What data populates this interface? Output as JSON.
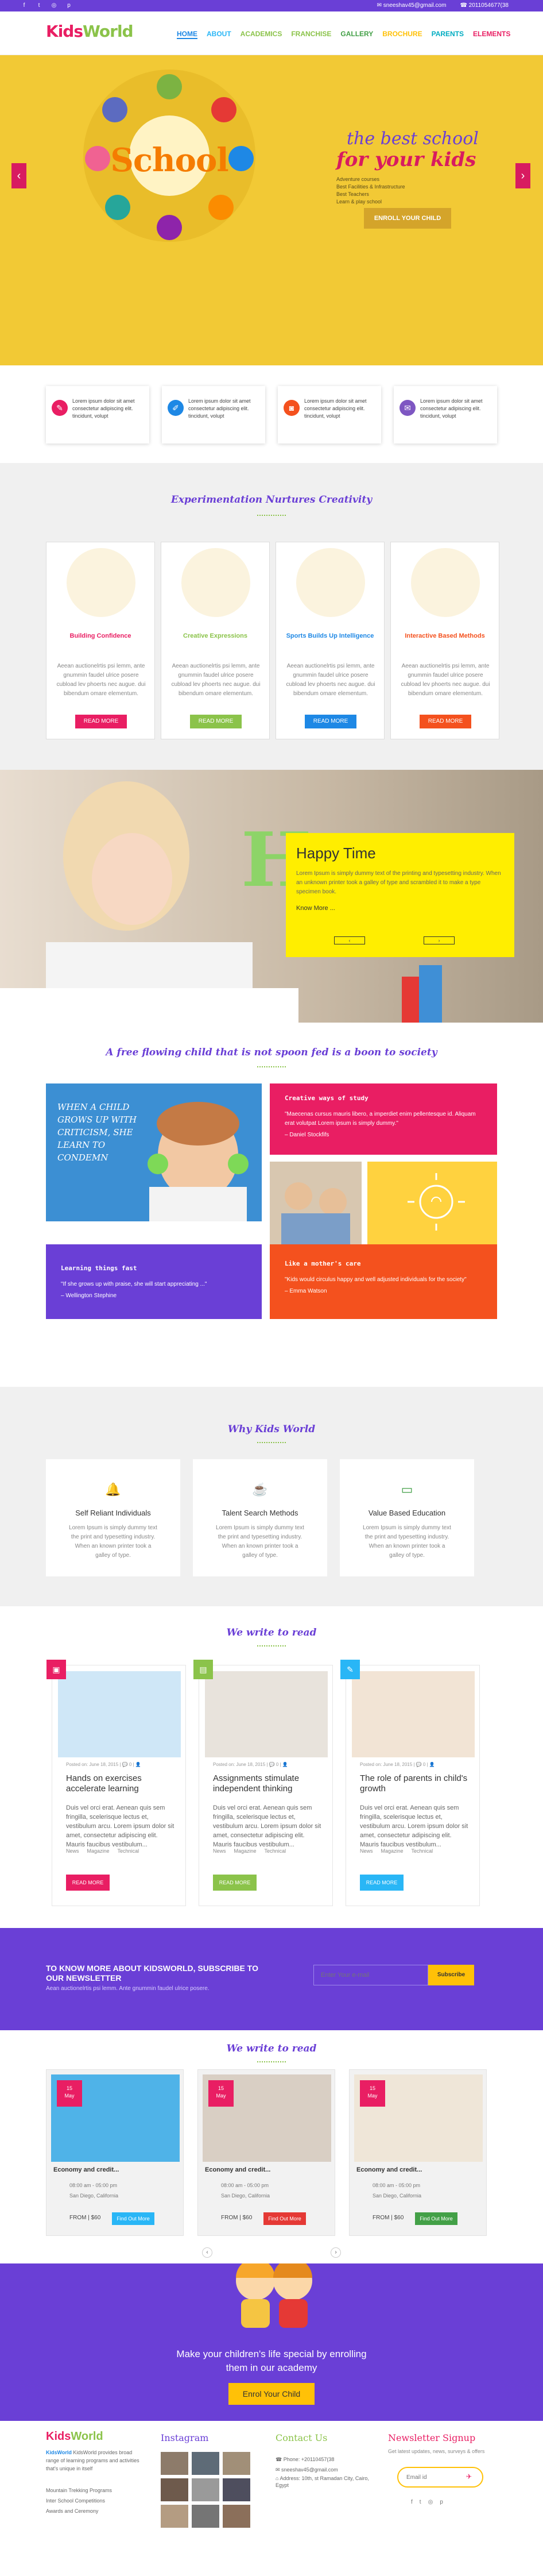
{
  "topbar": {
    "email": "sneeshav45@gmail.com",
    "phone": "2011054677(38",
    "social": [
      "facebook-icon",
      "twitter-icon",
      "instagram-icon",
      "pinterest-icon"
    ]
  },
  "nav": {
    "logo_part1": "Kids",
    "logo_part2": "World",
    "items": [
      {
        "label": "HOME",
        "color": "#1e88e5",
        "active": true
      },
      {
        "label": "ABOUT",
        "color": "#29b6f6"
      },
      {
        "label": "ACADEMICS",
        "color": "#8bc34a"
      },
      {
        "label": "FRANCHISE",
        "color": "#8bc34a"
      },
      {
        "label": "GALLERY",
        "color": "#43a047"
      },
      {
        "label": "BROCHURE",
        "color": "#ffc107"
      },
      {
        "label": "PARENTS",
        "color": "#00acc1"
      },
      {
        "label": "ELEMENTS",
        "color": "#e91e63"
      }
    ]
  },
  "hero": {
    "school_word": "School",
    "line1": "the best school",
    "line2": "for your kids",
    "bullets": [
      "Adventure courses",
      "Best Facilities & Infrastructure",
      "Best Teachers",
      "Learn & play school"
    ],
    "cta": "ENROLL YOUR CHILD"
  },
  "features": [
    {
      "text": "Lorem ipsum dolor sit amet consectetur adipiscing elit. tincidunt, volupt",
      "color": "#e91e63",
      "icon": "pencil-icon"
    },
    {
      "text": "Lorem ipsum dolor sit amet consectetur adipiscing elit. tincidunt, volupt",
      "color": "#1e88e5",
      "icon": "paint-brush-icon"
    },
    {
      "text": "Lorem ipsum dolor sit amet consectetur adipiscing elit. tincidunt, volupt",
      "color": "#f4511e",
      "icon": "camera-icon"
    },
    {
      "text": "Lorem ipsum dolor sit amet consectetur adipiscing elit. tincidunt, volupt",
      "color": "#7e57c2",
      "icon": "chat-icon"
    }
  ],
  "creativity": {
    "title": "Experimentation Nurtures Creativity",
    "cards": [
      {
        "title": "Building Confidence",
        "color": "#e91e63",
        "body": "Aeean auctionelrtis psi lemm, ante gnummin faudel ulrice posere cubload lev phoerts nec augue. dui bibendum omare elementum.",
        "btn": "READ MORE"
      },
      {
        "title": "Creative Expressions",
        "color": "#8bc34a",
        "body": "Aeean auctionelrtis psi lemm, ante gnummin faudel ulrice posere cubload lev phoerts nec augue. dui bibendum omare elementum.",
        "btn": "READ MORE"
      },
      {
        "title": "Sports Builds Up Intelligence",
        "color": "#1e88e5",
        "body": "Aeean auctionelrtis psi lemm, ante gnummin faudel ulrice posere cubload lev phoerts nec augue. dui bibendum omare elementum.",
        "btn": "READ MORE"
      },
      {
        "title": "Interactive Based Methods",
        "color": "#f4511e",
        "body": "Aeean auctionelrtis psi lemm, ante gnummin faudel ulrice posere cubload lev phoerts nec augue. dui bibendum omare elementum.",
        "btn": "READ MORE"
      }
    ]
  },
  "happy": {
    "big_letter": "H",
    "title": "Happy Time",
    "body": "Lorem Ipsum is simply dummy text of the printing and typesetting industry. When an unknown printer took a galley of type and scrambled it to make a type specimen book.",
    "link": "Know More ..."
  },
  "society": {
    "title": "A free flowing child that is not spoon fed is a boon to society",
    "chalk_text": "WHEN A CHILD GROWS UP WITH CRITICISM, SHE LEARN TO CONDEMN",
    "quotes": [
      {
        "title": "Creative ways of study",
        "body": "\"Maecenas cursus mauris libero, a imperdiet enim pellentesque id. Aliquam erat volutpat Lorem ipsum is simply dummy.\"",
        "author": "– Daniel Stockfifs"
      },
      {
        "title": "Learning things fast",
        "body": "\"If she grows up with praise, she will start appreciating ...\"",
        "author": "– Wellington Stephine"
      },
      {
        "title": "Like a mother's care",
        "body": "\"Kids would circulus happy and well adjusted individuals for the society\"",
        "author": "– Emma Watson"
      }
    ]
  },
  "why": {
    "title": "Why Kids World",
    "cards": [
      {
        "icon": "bell-icon",
        "color": "#7e57c2",
        "title": "Self Reliant Individuals",
        "body": "Lorem Ipsum is simply dummy text the print and typesetting industry. When an known printer took a galley of type."
      },
      {
        "icon": "coffee-cup-icon",
        "color": "#f4511e",
        "title": "Talent Search Methods",
        "body": "Lorem Ipsum is simply dummy text the print and typesetting industry. When an known printer took a galley of type."
      },
      {
        "icon": "monitor-icon",
        "color": "#43a047",
        "title": "Value Based Education",
        "body": "Lorem Ipsum is simply dummy text the print and typesetting industry. When an known printer took a galley of type."
      }
    ]
  },
  "blog": {
    "title": "We write to read",
    "posts": [
      {
        "color": "#e91e63",
        "icon": "person-icon",
        "meta": "Posted on: June 18, 2015 | 💬 0 | 👤",
        "title": "Hands on exercises accelerate learning",
        "body": "Duis vel orci erat. Aenean quis sem fringilla, scelerisque lectus et, vestibulum arcu. Lorem ipsum dolor sit amet, consectetur adipiscing elit. Mauris faucibus vestibulum...",
        "cats": [
          "News",
          "Magazine",
          "Technical"
        ],
        "btn": "READ MORE"
      },
      {
        "color": "#8bc34a",
        "icon": "image-icon",
        "meta": "Posted on: June 18, 2015 | 💬 0 | 👤",
        "title": "Assignments stimulate independent thinking",
        "body": "Duis vel orci erat. Aenean quis sem fringilla, scelerisque lectus et, vestibulum arcu. Lorem ipsum dolor sit amet, consectetur adipiscing elit. Mauris faucibus vestibulum...",
        "cats": [
          "News",
          "Magazine",
          "Technical"
        ],
        "btn": "READ MORE"
      },
      {
        "color": "#29b6f6",
        "icon": "pencil-square-icon",
        "meta": "Posted on: June 18, 2015 | 💬 0 | 👤",
        "title": "The role of parents in child's growth",
        "body": "Duis vel orci erat. Aenean quis sem fringilla, scelerisque lectus et, vestibulum arcu. Lorem ipsum dolor sit amet, consectetur adipiscing elit. Mauris faucibus vestibulum...",
        "cats": [
          "News",
          "Magazine",
          "Technical"
        ],
        "btn": "READ MORE"
      }
    ]
  },
  "subscribe": {
    "title": "TO KNOW MORE ABOUT KIDSWORLD, SUBSCRIBE TO OUR NEWSLETTER",
    "sub": "Aean auctionelrtis psi lemm. Ante gnummin faudel ulrice posere.",
    "placeholder": "Enter Your e-mail",
    "btn": "Subscribe"
  },
  "events": {
    "title": "We write to read",
    "items": [
      {
        "day": "15",
        "month": "May",
        "title": "Economy and credit...",
        "time": "08:00 am - 05:00 pm",
        "place": "San Diego, California",
        "price": "FROM | $60",
        "btn": "Find Out More",
        "btn_color": "#29b6f6"
      },
      {
        "day": "15",
        "month": "May",
        "title": "Economy and credit...",
        "time": "08:00 am - 05:00 pm",
        "place": "San Diego, California",
        "price": "FROM | $60",
        "btn": "Find Out More",
        "btn_color": "#e53935"
      },
      {
        "day": "15",
        "month": "May",
        "title": "Economy and credit...",
        "time": "08:00 am - 05:00 pm",
        "place": "San Diego, California",
        "price": "FROM | $60",
        "btn": "Find Out More",
        "btn_color": "#43a047"
      }
    ]
  },
  "enroll": {
    "line1": "Make your children's life special by enrolling",
    "line2": "them in our academy",
    "btn": "Enrol Your Child"
  },
  "footer": {
    "about_title": "KidsWorld",
    "about_body": "KidsWorld provides broad range of learning programs and activities that's unique in itself",
    "about_list": [
      "Mountain Trekking Programs",
      "Inter School Competitions",
      "Awards and Ceremony"
    ],
    "instagram_title": "Instagram",
    "contact_title": "Contact Us",
    "contact": [
      "Phone: +20110457(38",
      "sneeshav45@gmail.com",
      "Address: 10th, st Ramadan City, Cairo, Egypt"
    ],
    "newsletter_title": "Newsletter Signup",
    "newsletter_sub": "Get latest updates, news, surveys & offers",
    "newsletter_placeholder": "Email id"
  }
}
